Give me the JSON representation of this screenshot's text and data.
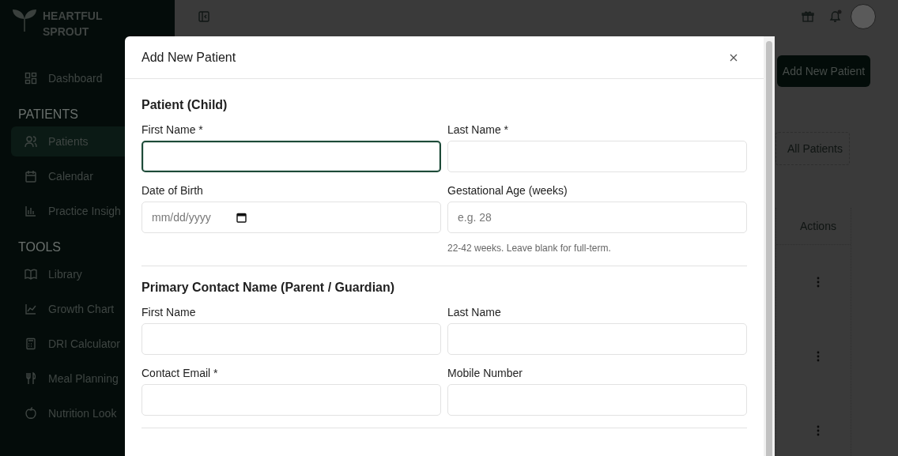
{
  "sidebar": {
    "brand": [
      "HEARTFUL",
      "SPROUT"
    ],
    "items": [
      {
        "kind": "link",
        "label": "Dashboard",
        "selected": false
      },
      {
        "kind": "section",
        "label": "PATIENTS"
      },
      {
        "kind": "link",
        "label": "Patients",
        "selected": true
      },
      {
        "kind": "link",
        "label": "Calendar",
        "selected": false
      },
      {
        "kind": "link",
        "label": "Practice Insigh",
        "selected": false
      },
      {
        "kind": "section",
        "label": "TOOLS"
      },
      {
        "kind": "link",
        "label": "Library",
        "selected": false
      },
      {
        "kind": "link",
        "label": "Growth Chart",
        "selected": false
      },
      {
        "kind": "link",
        "label": "DRI Calculator",
        "selected": false
      },
      {
        "kind": "link",
        "label": "Meal Planning",
        "selected": false
      },
      {
        "kind": "link",
        "label": "Nutrition Look",
        "selected": false
      }
    ]
  },
  "page": {
    "add_button": "Add New Patient",
    "filter_tab": "All Patients",
    "table": {
      "columns": [
        "Actions"
      ]
    }
  },
  "modal": {
    "title": "Add New Patient",
    "sections": [
      {
        "heading": "Patient (Child)",
        "fields": [
          {
            "kind": "text",
            "label": "First Name *",
            "focused": true
          },
          {
            "kind": "text",
            "label": "Last Name *",
            "focused": false
          },
          {
            "kind": "date",
            "label": "Date of Birth",
            "placeholder": "mm/dd/yyyy",
            "focused": false
          },
          {
            "kind": "text",
            "label": "Gestational Age (weeks)",
            "placeholder": "e.g. 28",
            "hint": "22-42 weeks. Leave blank for full-term.",
            "focused": false
          }
        ]
      },
      {
        "heading": "Primary Contact Name (Parent / Guardian)",
        "fields": [
          {
            "kind": "text",
            "label": "First Name",
            "focused": false
          },
          {
            "kind": "text",
            "label": "Last Name",
            "focused": false
          },
          {
            "kind": "text",
            "label": "Contact Email *",
            "focused": false
          },
          {
            "kind": "text",
            "label": "Mobile Number",
            "focused": false
          }
        ]
      }
    ]
  }
}
